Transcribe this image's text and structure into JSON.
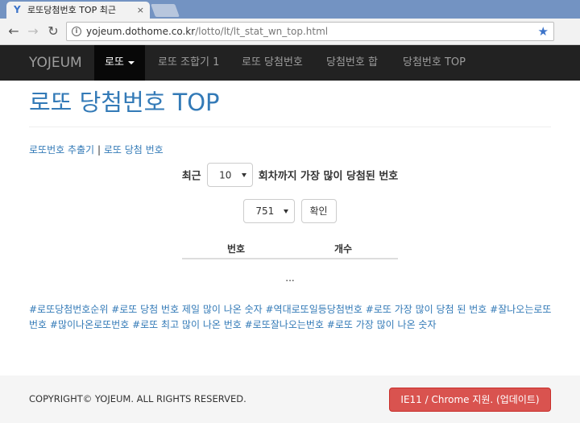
{
  "browser": {
    "tab_title": "로또당첨번호 TOP 최근",
    "tab_close": "×",
    "url_domain": "yojeum.dothome.co.kr",
    "url_path": "/lotto/lt/lt_stat_wn_top.html"
  },
  "navbar": {
    "brand": "YOJEUM",
    "items": [
      {
        "label": "로또"
      },
      {
        "label": "로또 조합기 1"
      },
      {
        "label": "로또 당첨번호"
      },
      {
        "label": "당첨번호 합"
      },
      {
        "label": "당첨번호 TOP"
      }
    ]
  },
  "page": {
    "title": "로또 당첨번호 TOP",
    "link1": "로또번호 추출기",
    "separator": "|",
    "link2": "로또 당첨 번호",
    "round_prefix": "최근",
    "round_select_value": "10",
    "round_suffix": "회차까지 가장 많이 당첨된 번호",
    "draw_select_value": "751",
    "confirm_label": "확인",
    "table_headers": [
      "번호",
      "개수"
    ],
    "table_placeholder": "...",
    "tags": "#로또당첨번호순위 #로또 당첨 번호 제일 많이 나온 숫자 #역대로또일등당첨번호 #로또 가장 많이 당첨 된 번호 #잘나오는로또번호 #많이나온로또번호 #로또 최고 많이 나온 번호 #로또잘나오는번호 #로또 가장 많이 나온 숫자"
  },
  "footer": {
    "copyright": "COPYRIGHT© YOJEUM. ALL RIGHTS RESERVED.",
    "update_button": "IE11 / Chrome 지원. (업데이트)"
  },
  "colors": {
    "link": "#337ab7",
    "navbar": "#222222",
    "danger": "#d9534f"
  }
}
